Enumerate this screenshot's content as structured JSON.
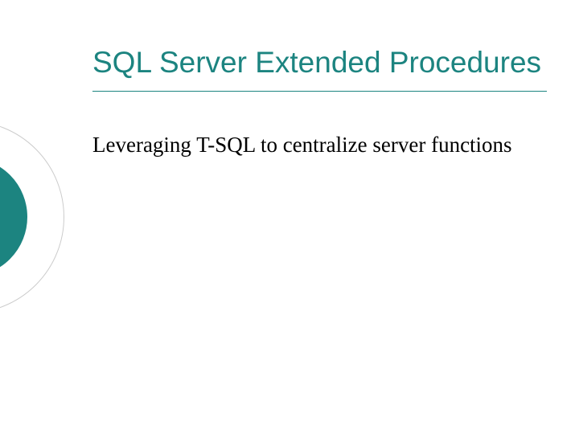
{
  "slide": {
    "title": "SQL Server Extended Procedures",
    "subtitle": "Leveraging T-SQL to centralize server functions"
  },
  "colors": {
    "accent": "#1c8480"
  }
}
